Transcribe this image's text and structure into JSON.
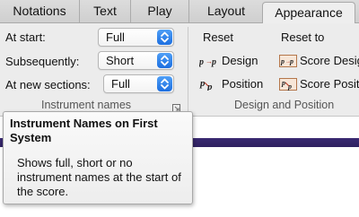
{
  "tabs": [
    {
      "label": "Notations",
      "active": false
    },
    {
      "label": "Text",
      "active": false
    },
    {
      "label": "Play",
      "active": false
    },
    {
      "label": "Layout",
      "active": false
    },
    {
      "label": "Appearance",
      "active": true
    }
  ],
  "instrument_names": {
    "group_title": "Instrument names",
    "rows": [
      {
        "label": "At start:",
        "value": "Full"
      },
      {
        "label": "Subsequently:",
        "value": "Short"
      },
      {
        "label": "At new sections:",
        "value": "Full"
      }
    ]
  },
  "design_position": {
    "group_title": "Design and Position",
    "reset_label": "Reset",
    "reset_to_label": "Reset to",
    "reset_design": "Design",
    "reset_position": "Position",
    "score_design": "Score Design",
    "score_position": "Score Position"
  },
  "tooltip": {
    "title": "Instrument Names on First System",
    "body": "Shows full, short or no instrument names at the start of the score."
  },
  "colors": {
    "stepper_blue": "#2f7ff0",
    "purple_band": "#35286a",
    "icon_red": "#b2321e"
  }
}
